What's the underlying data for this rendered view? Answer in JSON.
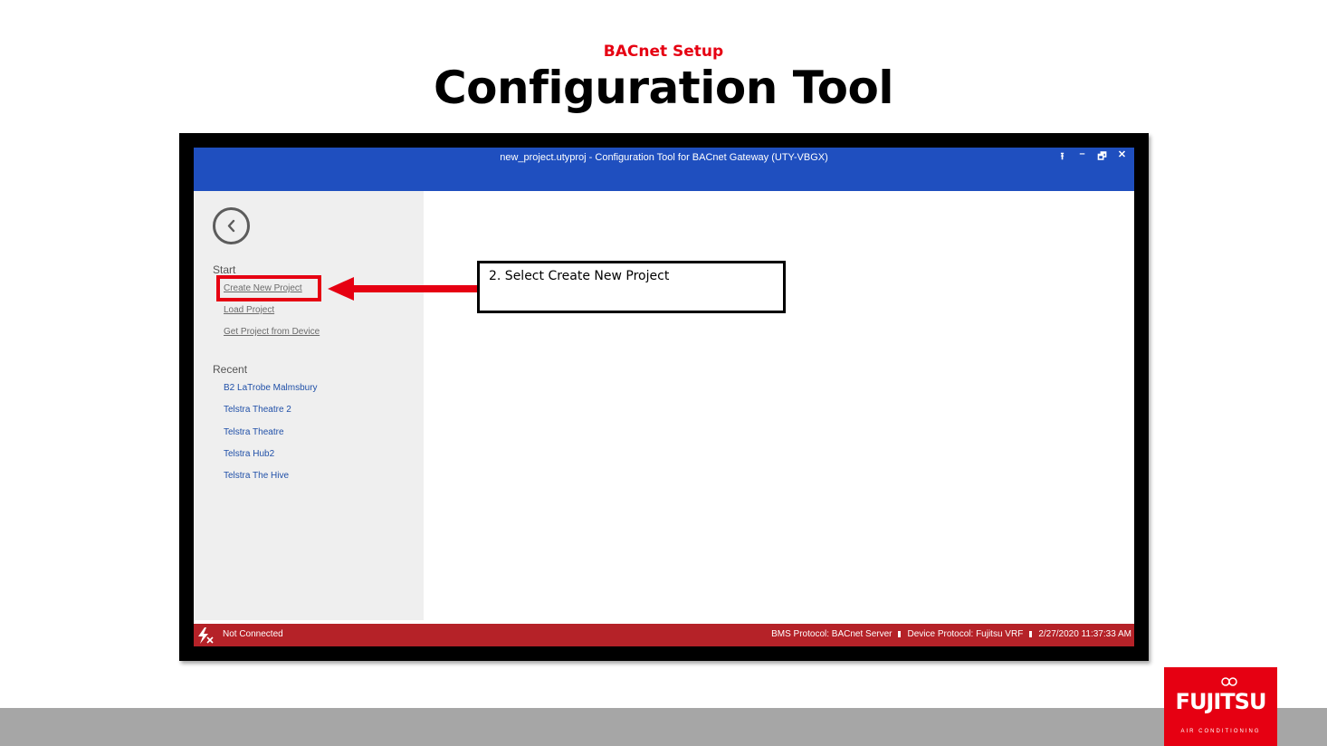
{
  "slide": {
    "subtitle": "BACnet Setup",
    "title": "Configuration Tool"
  },
  "window": {
    "title": "new_project.utyproj - Configuration Tool for BACnet Gateway (UTY-VBGX)",
    "controls": {
      "upload": "⭱",
      "minimize": "–",
      "restore": "🗗",
      "close": "✕"
    }
  },
  "sidebar": {
    "back_icon": "chevron-left-icon",
    "start_heading": "Start",
    "start_items": [
      "Create New Project",
      "Load Project",
      "Get Project from Device"
    ],
    "recent_heading": "Recent",
    "recent_items": [
      "B2 LaTrobe Malmsbury",
      "Telstra Theatre 2",
      "Telstra Theatre",
      "Telstra Hub2",
      "Telstra The Hive"
    ]
  },
  "callout": {
    "text": "2. Select Create New Project",
    "highlight_color": "#e60012"
  },
  "statusbar": {
    "connection": "Not Connected",
    "bms_protocol": "BMS Protocol: BACnet Server",
    "device_protocol": "Device Protocol: Fujitsu VRF",
    "timestamp": "2/27/2020 11:37:33 AM"
  },
  "colors": {
    "titlebar": "#1f4fbf",
    "statusbar": "#b52228",
    "accent_red": "#e60012"
  },
  "logo": {
    "name": "FUJITSU",
    "tagline": "AIR CONDITIONING"
  }
}
